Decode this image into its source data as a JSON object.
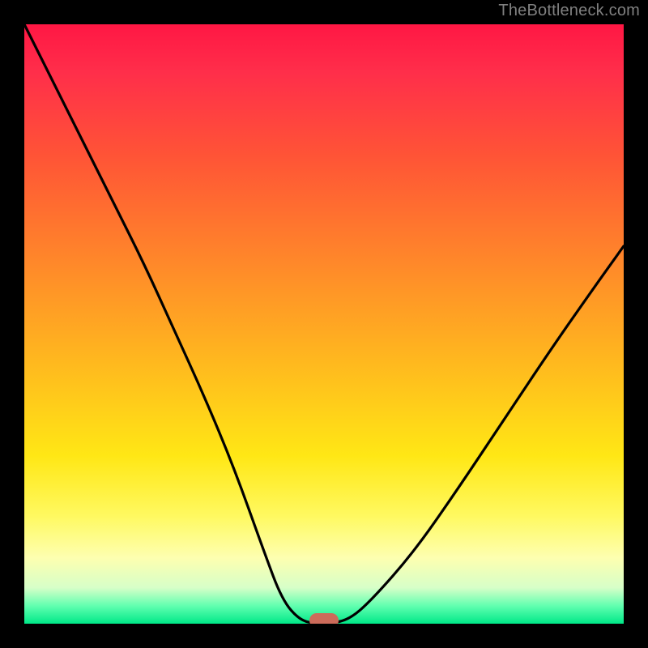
{
  "watermark": "TheBottleneck.com",
  "chart_data": {
    "type": "line",
    "title": "",
    "xlabel": "",
    "ylabel": "",
    "xlim": [
      0,
      100
    ],
    "ylim": [
      0,
      100
    ],
    "grid": false,
    "legend": false,
    "series": [
      {
        "name": "bottleneck-curve",
        "x": [
          0,
          5,
          10,
          15,
          20,
          25,
          30,
          35,
          40,
          43,
          46,
          49,
          50,
          54,
          58,
          65,
          72,
          80,
          88,
          95,
          100
        ],
        "y": [
          100,
          90,
          80,
          70,
          60,
          49,
          38,
          26,
          12,
          4,
          0.5,
          0,
          0,
          0.5,
          4,
          12,
          22,
          34,
          46,
          56,
          63
        ]
      }
    ],
    "marker": {
      "x": 50,
      "y": 0,
      "color": "#cc6b5a"
    },
    "gradient_stops": [
      {
        "pos": 0,
        "color": "#ff1744"
      },
      {
        "pos": 50,
        "color": "#ffc31c"
      },
      {
        "pos": 82,
        "color": "#fff960"
      },
      {
        "pos": 100,
        "color": "#00e888"
      }
    ]
  }
}
